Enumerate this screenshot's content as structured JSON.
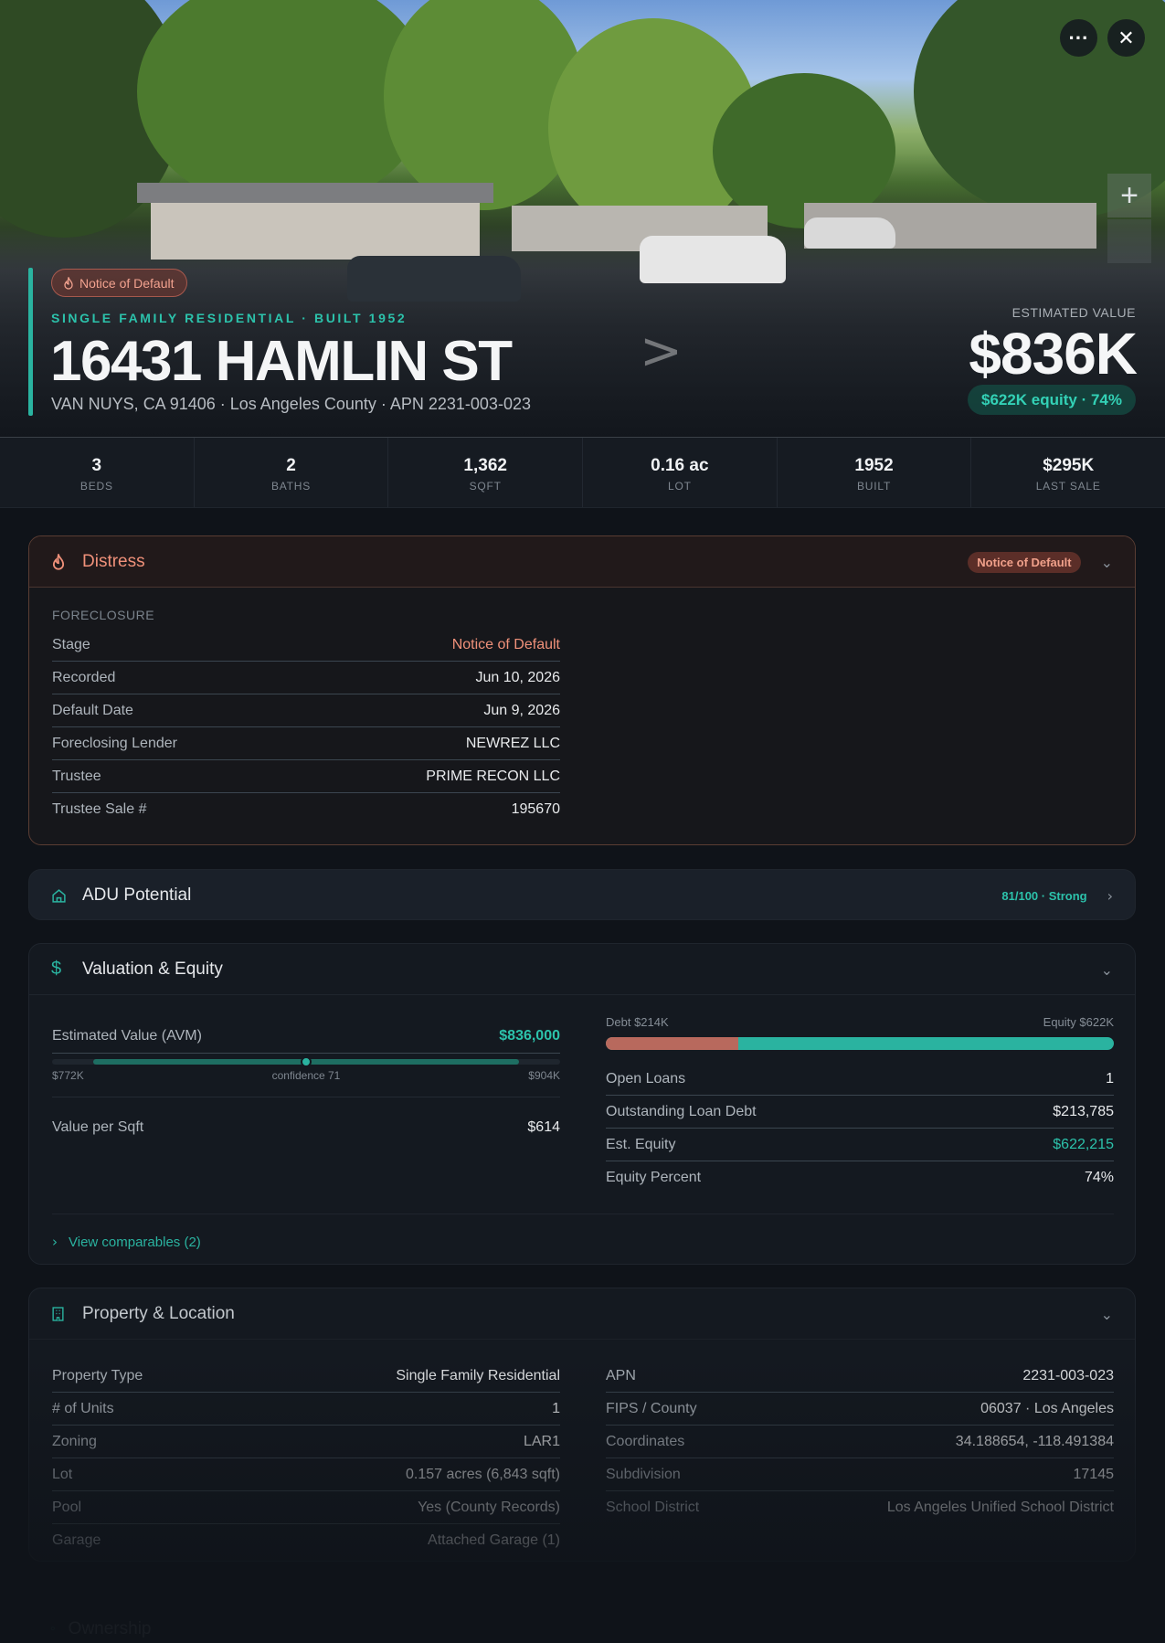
{
  "hero": {
    "more_label": "···",
    "close_label": "✕",
    "zoom_label": "+",
    "badge": "Notice of Default",
    "type_line": "SINGLE FAMILY RESIDENTIAL · BUILT 1952",
    "address": "16431 HAMLIN ST",
    "subline": "VAN NUYS, CA 91406 · Los Angeles County · APN 2231-003-023",
    "est_label": "ESTIMATED VALUE",
    "est_value": "$836K",
    "equity": "$622K equity · 74%"
  },
  "stats": [
    {
      "value": "3",
      "label": "BEDS"
    },
    {
      "value": "2",
      "label": "BATHS"
    },
    {
      "value": "1,362",
      "label": "SQFT"
    },
    {
      "value": "0.16 ac",
      "label": "LOT"
    },
    {
      "value": "1952",
      "label": "BUILT"
    },
    {
      "value": "$295K",
      "label": "LAST SALE"
    }
  ],
  "distress": {
    "title": "Distress",
    "badge": "Notice of Default",
    "section": "FORECLOSURE",
    "rows": [
      {
        "k": "Stage",
        "v": "Notice of Default"
      },
      {
        "k": "Recorded",
        "v": "Jun 10, 2026"
      },
      {
        "k": "Default Date",
        "v": "Jun 9, 2026"
      },
      {
        "k": "Foreclosing Lender",
        "v": "NEWREZ LLC"
      },
      {
        "k": "Trustee",
        "v": "PRIME RECON LLC"
      },
      {
        "k": "Trustee Sale #",
        "v": "195670"
      }
    ]
  },
  "adu": {
    "title": "ADU Potential",
    "score": "81/100 · Strong"
  },
  "valuation": {
    "title": "Valuation & Equity",
    "avm_label": "Estimated Value (AVM)",
    "avm_value": "$836,000",
    "range_low": "$772K",
    "range_high": "$904K",
    "confidence": "confidence 71",
    "confidence_fraction": 0.5,
    "vps_label": "Value per Sqft",
    "vps_value": "$614",
    "debt_label": "Debt $214K",
    "equity_label": "Equity $622K",
    "debt_fraction": 0.26,
    "loan_rows": [
      {
        "k": "Open Loans",
        "v": "1"
      },
      {
        "k": "Outstanding Loan Debt",
        "v": "$213,785"
      },
      {
        "k": "Est. Equity",
        "v": "$622,215"
      },
      {
        "k": "Equity Percent",
        "v": "74%"
      }
    ],
    "comps_link": "View comparables (2)"
  },
  "property": {
    "title": "Property & Location",
    "left_rows": [
      {
        "k": "Property Type",
        "v": "Single Family Residential"
      },
      {
        "k": "# of Units",
        "v": "1"
      },
      {
        "k": "Zoning",
        "v": "LAR1"
      },
      {
        "k": "Lot",
        "v": "0.157 acres (6,843 sqft)"
      },
      {
        "k": "Pool",
        "v": "Yes (County Records)"
      },
      {
        "k": "Garage",
        "v": "Attached Garage (1)"
      }
    ],
    "right_rows": [
      {
        "k": "APN",
        "v": "2231-003-023"
      },
      {
        "k": "FIPS / County",
        "v": "06037 · Los Angeles"
      },
      {
        "k": "Coordinates",
        "v": "34.188654, -118.491384"
      },
      {
        "k": "Subdivision",
        "v": "17145"
      },
      {
        "k": "School District",
        "v": "Los Angeles Unified School District"
      }
    ]
  },
  "ownership": {
    "title": "Ownership"
  },
  "colors": {
    "accent": "#2ab3a0",
    "distress": "#f0917a",
    "debt": "#b8695d"
  }
}
